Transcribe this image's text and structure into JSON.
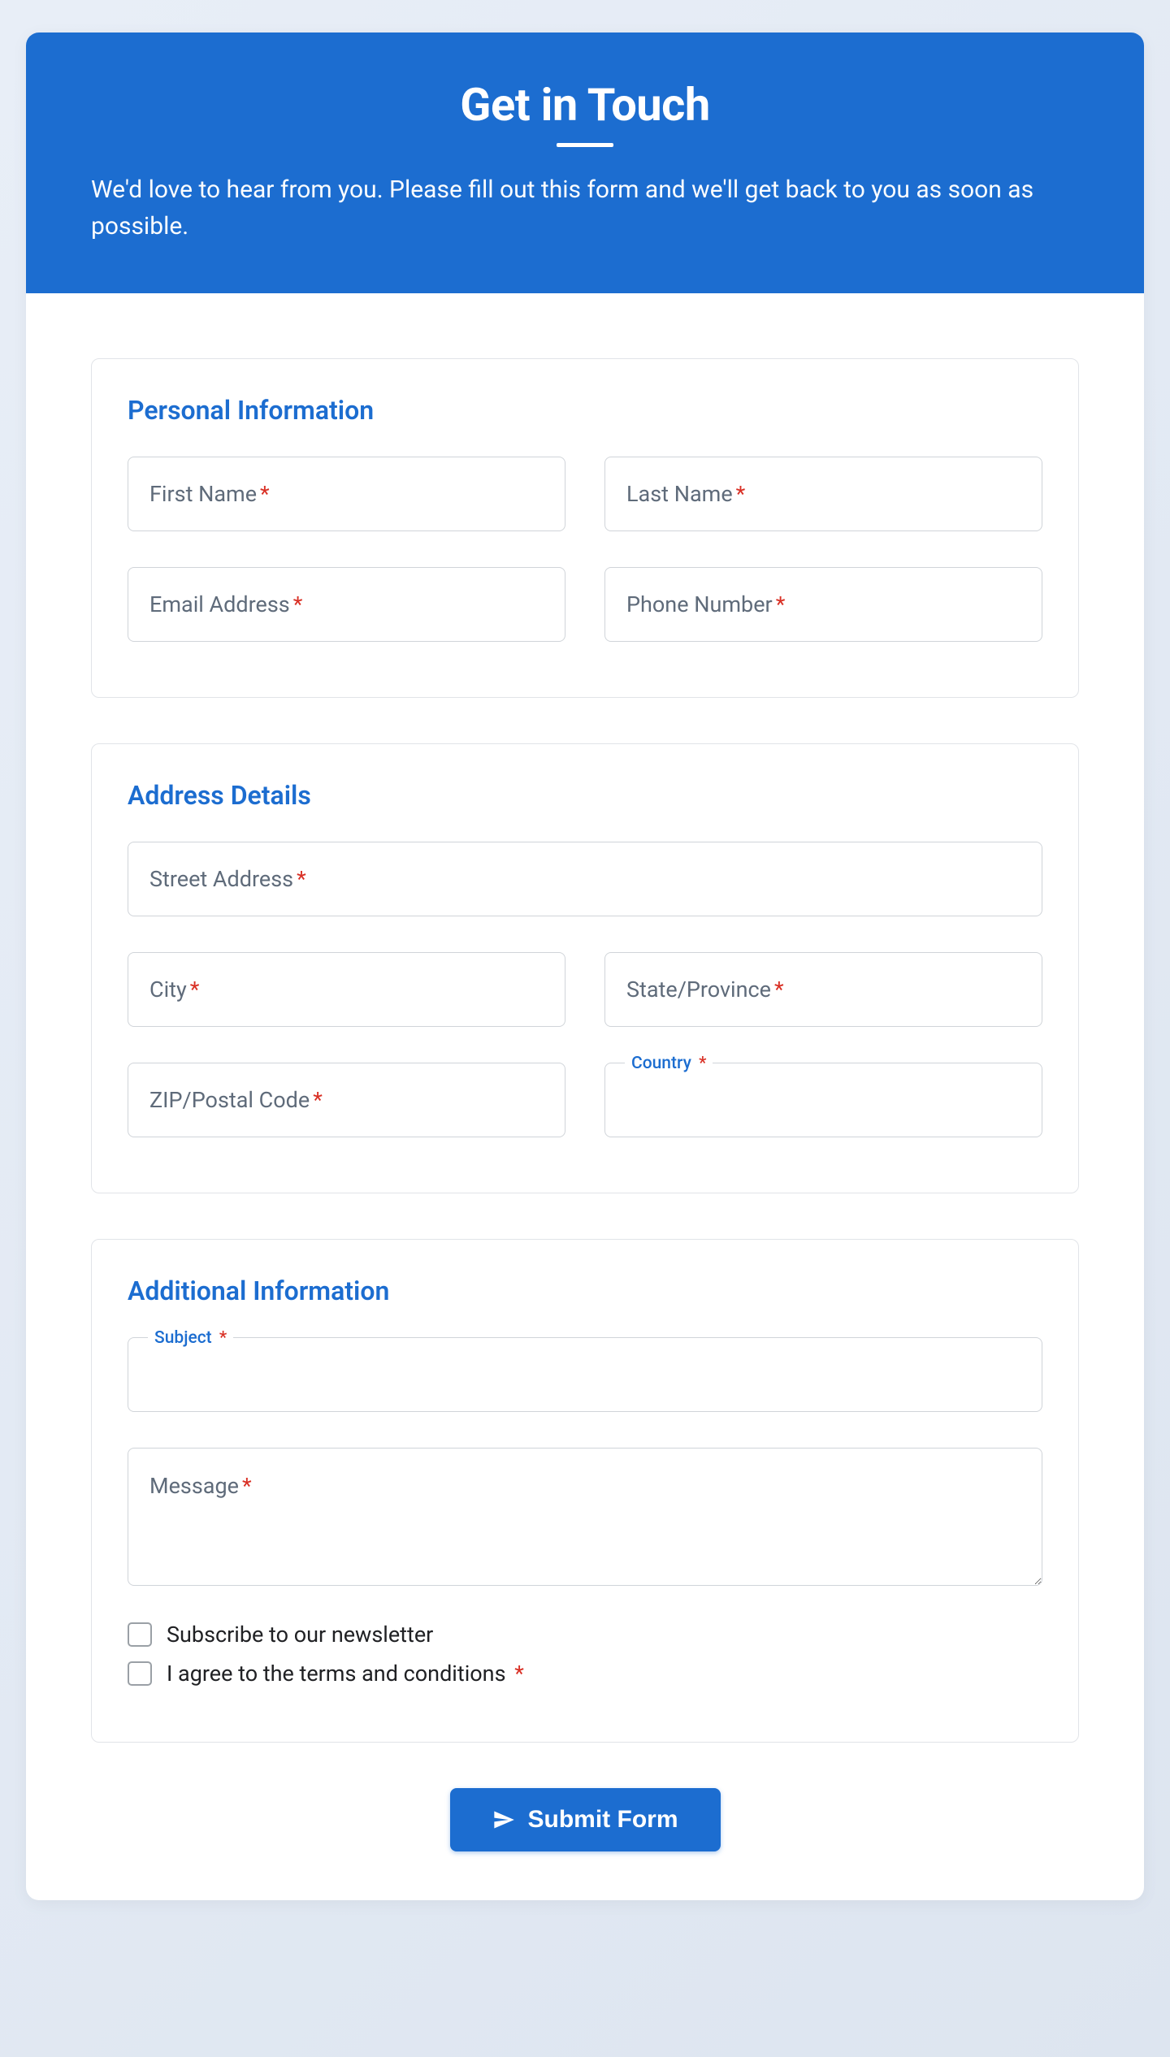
{
  "header": {
    "title": "Get in Touch",
    "subtitle": "We'd love to hear from you. Please fill out this form and we'll get back to you as soon as possible."
  },
  "sections": {
    "personal": {
      "title": "Personal Information",
      "fields": {
        "first_name": {
          "label": "First Name",
          "required": true
        },
        "last_name": {
          "label": "Last Name",
          "required": true
        },
        "email": {
          "label": "Email Address",
          "required": true
        },
        "phone": {
          "label": "Phone Number",
          "required": true
        }
      }
    },
    "address": {
      "title": "Address Details",
      "fields": {
        "street": {
          "label": "Street Address",
          "required": true
        },
        "city": {
          "label": "City",
          "required": true
        },
        "state": {
          "label": "State/Province",
          "required": true
        },
        "zip": {
          "label": "ZIP/Postal Code",
          "required": true
        },
        "country": {
          "label": "Country",
          "required": true
        }
      }
    },
    "additional": {
      "title": "Additional Information",
      "fields": {
        "subject": {
          "label": "Subject",
          "required": true
        },
        "message": {
          "label": "Message",
          "required": true
        }
      },
      "checkboxes": {
        "newsletter": {
          "label": "Subscribe to our newsletter",
          "required": false
        },
        "terms": {
          "label": "I agree to the terms and conditions",
          "required": true
        }
      }
    }
  },
  "submit": {
    "label": "Submit Form"
  },
  "required_marker": "*"
}
